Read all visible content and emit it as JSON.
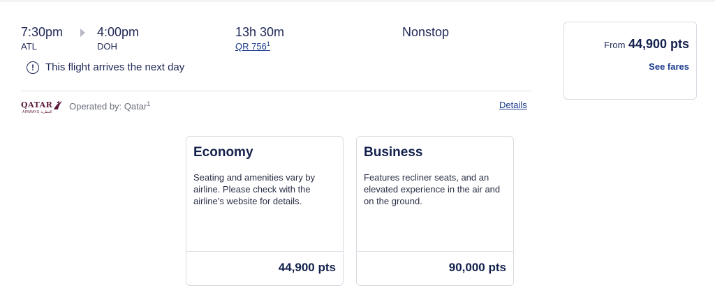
{
  "flight": {
    "depart_time": "7:30pm",
    "depart_code": "ATL",
    "arrive_time": "4:00pm",
    "arrive_code": "DOH",
    "duration": "13h 30m",
    "flight_number": "QR 756",
    "flight_number_footnote": "1",
    "stops": "Nonstop",
    "notice": "This flight arrives the next day",
    "notice_icon": "info-circle-icon"
  },
  "operator": {
    "logo_text": "QATAR",
    "logo_subtext": "AIRWAYS القطرية",
    "logo_color": "#5c1a3b",
    "operated_label": "Operated by: Qatar",
    "operated_footnote": "1",
    "details_link": "Details"
  },
  "fare_summary": {
    "from_label": "From",
    "from_value": "44,900 pts",
    "see_fares_label": "See fares"
  },
  "cabins": [
    {
      "title": "Economy",
      "description": "Seating and amenities vary by airline. Please check with the airline’s website for details.",
      "price": "44,900 pts"
    },
    {
      "title": "Business",
      "description": "Features recliner seats, and an elevated experience in the air and on the ground.",
      "price": "90,000 pts"
    }
  ],
  "colors": {
    "brand_navy": "#14214d",
    "link_blue": "#1a3a8c",
    "border": "#d9dbe2"
  }
}
